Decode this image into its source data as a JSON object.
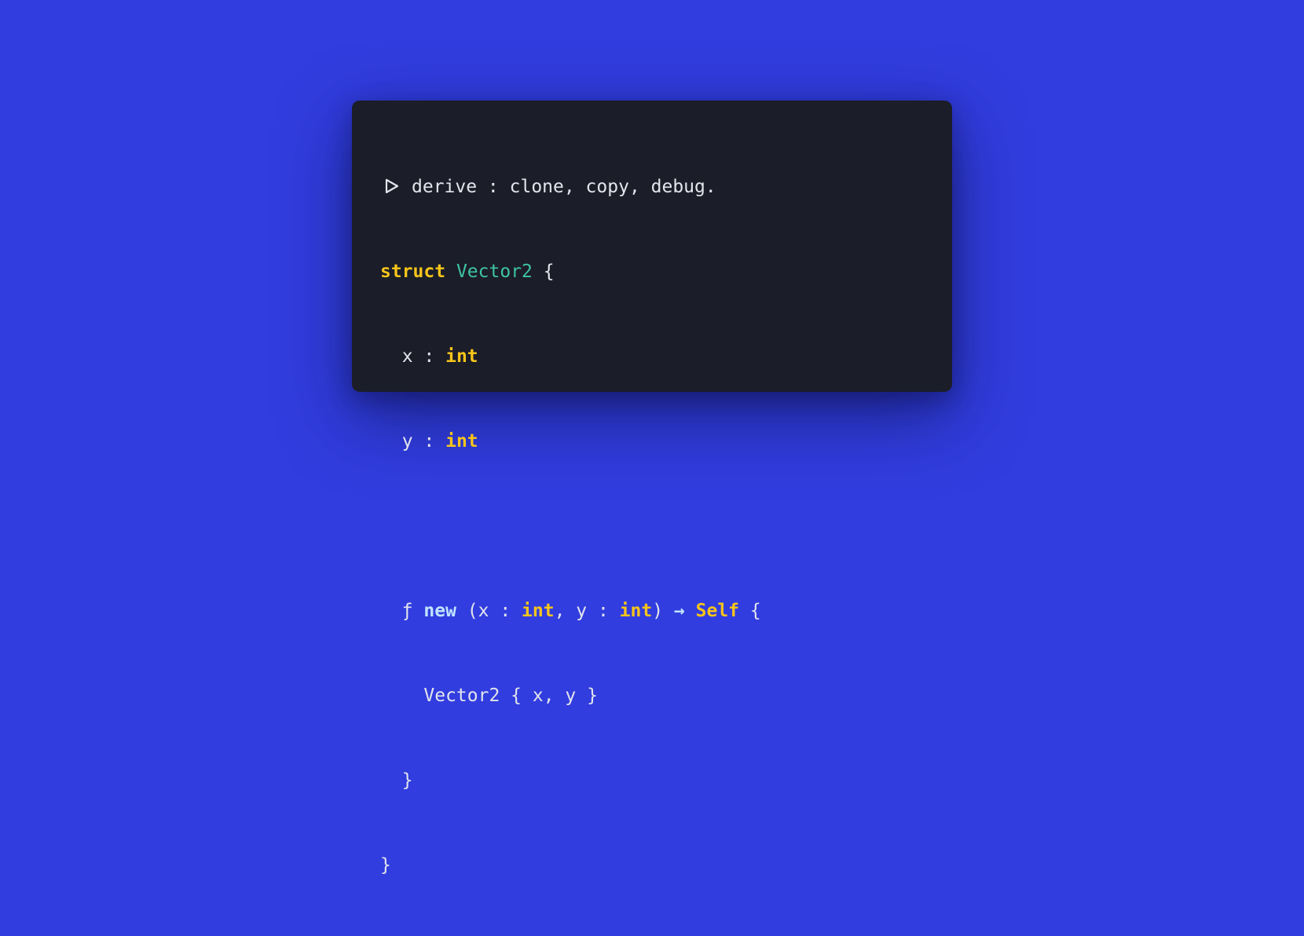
{
  "annotation": {
    "icon": "play-triangle-outline",
    "text": "derive : clone, copy, debug."
  },
  "code": {
    "struct_keyword": "struct",
    "struct_name": "Vector2",
    "open_brace": " {",
    "field_x_name": "  x : ",
    "field_x_type": "int",
    "field_y_name": "  y : ",
    "field_y_type": "int",
    "fn_symbol": "  ƒ ",
    "fn_name": "new",
    "param_open": " (x : ",
    "param_x_type": "int",
    "param_sep": ", y : ",
    "param_y_type": "int",
    "param_close": ") ",
    "arrow": "→",
    "return_space": " ",
    "return_type": "Self",
    "fn_open_brace": " {",
    "body_line": "    Vector2 { x, y }",
    "fn_close_brace": "  }",
    "struct_close_brace": "}"
  },
  "colors": {
    "background": "#313dde",
    "panel": "#1b1d28",
    "keyword": "#f7c51b",
    "type_name": "#3ec4a4",
    "function_name": "#bfe4ff",
    "text": "#e3e5ec"
  }
}
